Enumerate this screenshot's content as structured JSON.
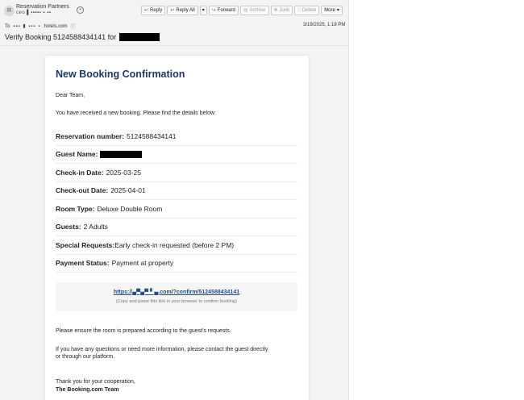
{
  "header": {
    "avatar_initial": "R",
    "sender_name": "Reservation Partners",
    "sender_email": "ceo▐ ▪▪▪▪▪ ▪ ▪▪",
    "to_label": "To",
    "to_domain": "hotels.com",
    "date": "3/19/2025, 1:18 PM",
    "subject": "Verify Booking 5124588434141 for"
  },
  "toolbar": {
    "reply": "Reply",
    "reply_all": "Reply All",
    "forward": "Forward",
    "archive": "Archive",
    "junk": "Junk",
    "delete": "Delete",
    "more": "More"
  },
  "email": {
    "title": "New Booking Confirmation",
    "greeting": "Dear Team,",
    "intro": "You have received a new booking. Please find the details below:",
    "details": [
      {
        "label": "Reservation number:",
        "value": "5124588434141"
      },
      {
        "label": "Guest Name:",
        "value": ""
      },
      {
        "label": "Check-in Date:",
        "value": "2025-03-25"
      },
      {
        "label": "Check-out Date:",
        "value": "2025-04-01"
      },
      {
        "label": "Room Type:",
        "value": "Deluxe Double Room"
      },
      {
        "label": "Guests:",
        "value": "2 Adults"
      },
      {
        "label": "Special Requests:",
        "value": "Early check-in requested (before 2 PM)"
      },
      {
        "label": "Payment Status:",
        "value": "Payment at property"
      }
    ],
    "link_text": "https://▄▀▄▀ ▘▄.com/?confirm/5124588434141",
    "link_hint": "(Copy and paste this link in your browser to confirm booking)",
    "ensure": "Please ensure the room is prepared according to the guest's requests.",
    "questions_1": "If you have any questions or need more information, please contact the guest directly",
    "questions_2": "or through our platform.",
    "thanks": "Thank you for your cooperation,",
    "signature": "The Booking.com Team"
  }
}
